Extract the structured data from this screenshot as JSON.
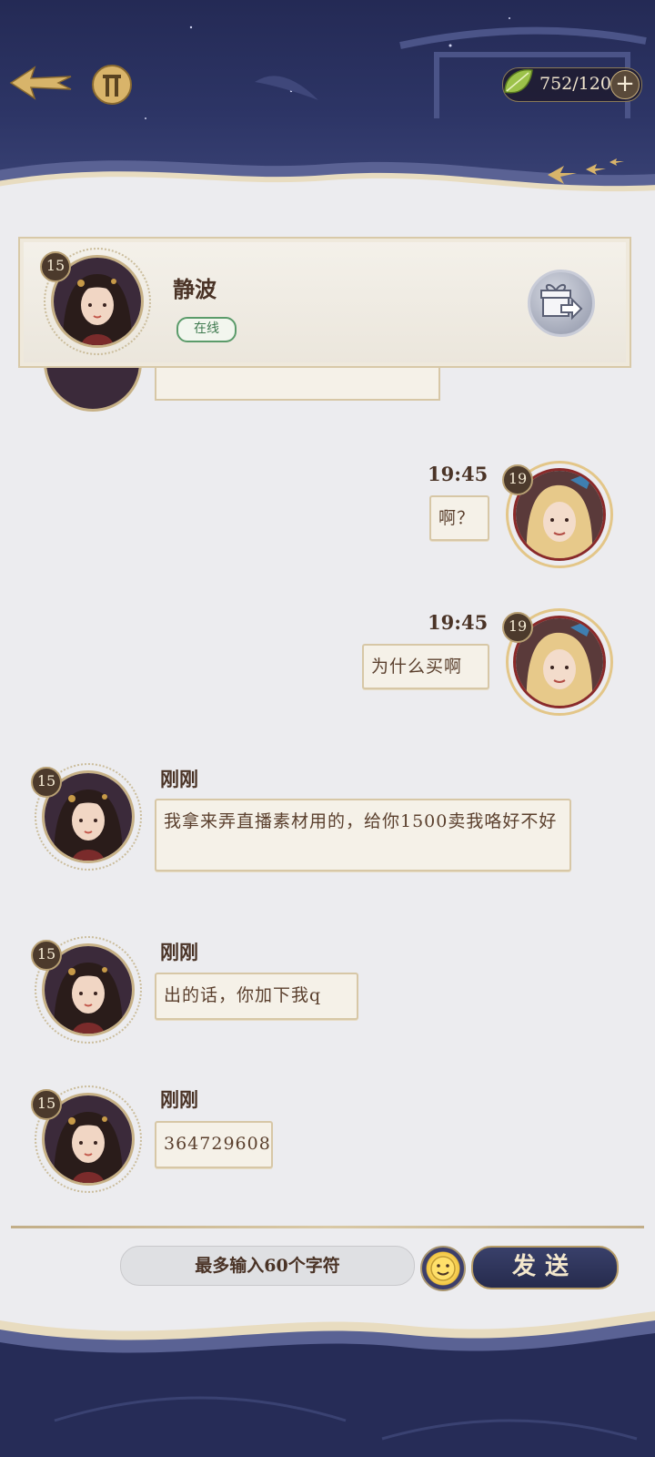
{
  "header": {
    "currency_value": "752/120",
    "plus_label": "+",
    "back_icon": "back-arrow-icon",
    "home_icon": "home-gate-icon"
  },
  "friend": {
    "name": "静波",
    "level": "15",
    "status": "在线",
    "gift_icon": "gift-send-icon"
  },
  "messages": [
    {
      "side": "right",
      "time": "19:45",
      "level": "19",
      "text": "啊？"
    },
    {
      "side": "right",
      "time": "19:45",
      "level": "19",
      "text": "为什么买啊"
    },
    {
      "side": "left",
      "name": "刚刚",
      "level": "15",
      "text": "我拿来弄直播素材用的，给你1500卖我咯好不好"
    },
    {
      "side": "left",
      "name": "刚刚",
      "level": "15",
      "text": "出的话，你加下我q"
    },
    {
      "side": "left",
      "name": "刚刚",
      "level": "15",
      "text": "364729608"
    }
  ],
  "composer": {
    "placeholder": "最多输入60个字符",
    "send_label": "发送",
    "emoji_icon": "emoji-icon"
  },
  "colors": {
    "header_bg": "#2d3566",
    "gold": "#c9a45e",
    "bubble_bg": "#f5f1e8",
    "online_green": "#3f7a4f"
  }
}
